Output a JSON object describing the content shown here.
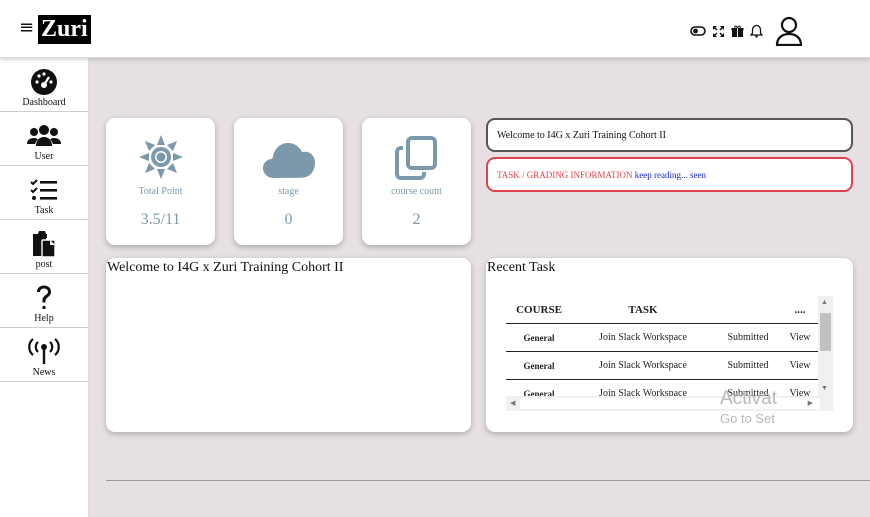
{
  "header": {
    "menu_icon": "hamburger-icon",
    "logo_text": "Zuri",
    "icons": [
      "toggle-icon",
      "fullscreen-icon",
      "gift-icon",
      "bell-icon",
      "user-icon"
    ]
  },
  "sidebar": {
    "items": [
      {
        "label": "Dashboard",
        "icon": "dashboard-icon"
      },
      {
        "label": "User",
        "icon": "users-icon"
      },
      {
        "label": "Task",
        "icon": "tasks-icon"
      },
      {
        "label": "post",
        "icon": "clipboard-icon"
      },
      {
        "label": "Help",
        "icon": "question-icon"
      },
      {
        "label": "News",
        "icon": "broadcast-icon"
      }
    ]
  },
  "stats": [
    {
      "label": "Total Point",
      "value": "3.5/11",
      "icon": "sun-icon"
    },
    {
      "label": "stage",
      "value": "0",
      "icon": "cloud-icon"
    },
    {
      "label": "course count",
      "value": "2",
      "icon": "copy-icon"
    }
  ],
  "welcome_box": {
    "text": "Welcome to I4G x Zuri Training Cohort II"
  },
  "task_info": {
    "label": "TASK / GRADING INFORMATION",
    "link": "keep reading... seen"
  },
  "welcome_panel": {
    "title": "Welcome to I4G x Zuri Training Cohort II"
  },
  "recent_task": {
    "title": "Recent Task",
    "columns": [
      "COURSE",
      "TASK",
      "",
      "...."
    ],
    "rows": [
      {
        "course": "General",
        "task": "Join Slack Workspace",
        "status": "Submitted",
        "action": "View"
      },
      {
        "course": "General",
        "task": "Join Slack Workspace",
        "status": "Submitted",
        "action": "View"
      },
      {
        "course": "General",
        "task": "Join Slack Workspace",
        "status": "Submitted",
        "action": "View"
      }
    ]
  },
  "watermark": {
    "line1": "Activat",
    "line2": "Go to Set"
  },
  "colors": {
    "accent_red": "#e0424d",
    "stat_blue": "#7b99aa",
    "link_blue": "#1a2ad6",
    "background": "#e6e0e2"
  }
}
